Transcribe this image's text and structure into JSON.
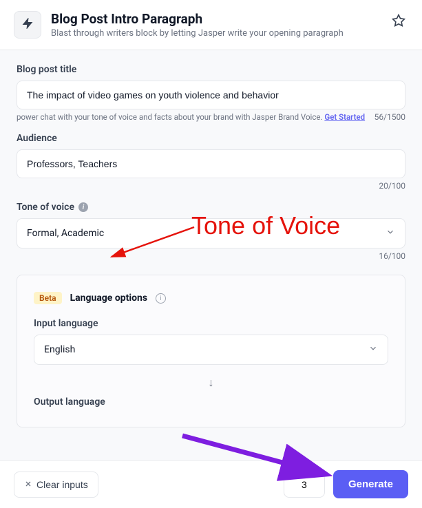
{
  "header": {
    "title": "Blog Post Intro Paragraph",
    "subtitle": "Blast through writers block by letting Jasper write your opening paragraph"
  },
  "fields": {
    "blog_title": {
      "label": "Blog post title",
      "value": "The impact of video games on youth violence and behavior",
      "counter": "56/1500",
      "hint_text": "power chat with your tone of voice and facts about your brand with Jasper Brand Voice.",
      "hint_link": "Get Started"
    },
    "audience": {
      "label": "Audience",
      "value": "Professors, Teachers",
      "counter": "20/100"
    },
    "tone": {
      "label": "Tone of voice",
      "value": "Formal, Academic",
      "counter": "16/100"
    }
  },
  "language": {
    "badge": "Beta",
    "title": "Language options",
    "input_label": "Input language",
    "input_value": "English",
    "output_label": "Output language"
  },
  "footer": {
    "clear": "Clear inputs",
    "count": "3",
    "generate": "Generate"
  },
  "annotations": {
    "tone_label": "Tone of Voice"
  }
}
